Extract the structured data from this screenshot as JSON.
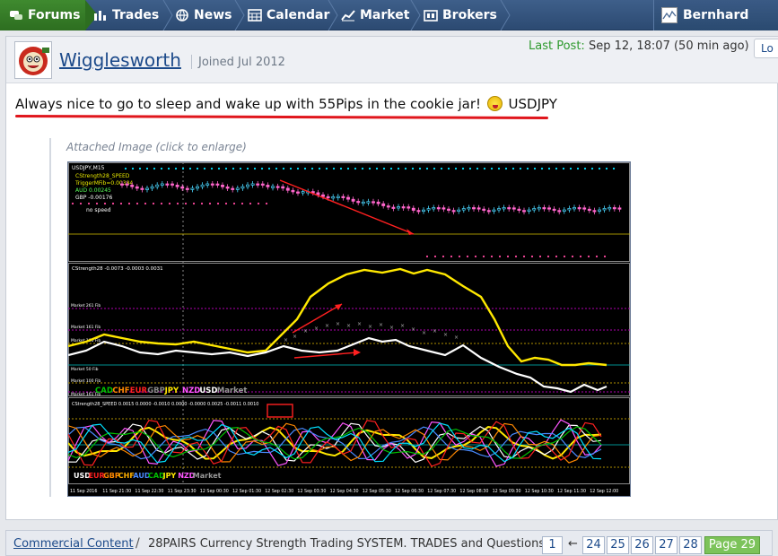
{
  "nav": {
    "items": [
      {
        "label": "Forums",
        "icon": "forums-icon"
      },
      {
        "label": "Trades",
        "icon": "bar-chart-icon"
      },
      {
        "label": "News",
        "icon": "globe-icon"
      },
      {
        "label": "Calendar",
        "icon": "calendar-icon"
      },
      {
        "label": "Market",
        "icon": "line-chart-icon"
      },
      {
        "label": "Brokers",
        "icon": "broker-icon"
      }
    ],
    "user": "Bernhard"
  },
  "post": {
    "username": "Wigglesworth",
    "joined": "Joined Jul 2012",
    "last_post_label": "Last Post:",
    "last_post_value": "Sep 12, 18:07 (50 min ago)",
    "header_button": "Lo",
    "text_before": "Always nice to go to sleep and wake up with 55Pips in the cookie jar! ",
    "text_after": " USDJPY",
    "attached_label": "Attached Image (click to enlarge)"
  },
  "chart": {
    "price_panel_title": "USDJPY,M15",
    "indicator_lines": [
      "CStrength28_SPEED",
      "TriggerMFib=0.00384",
      "AUD 0.00245",
      "GBP -0.00176",
      "no speed"
    ],
    "strength_title": "CStrength28 -0.0073 -0.0003 0.0031",
    "fib_labels": [
      "Market 261 Fib",
      "Market 161 Fib",
      "Market 100 Fib",
      "Market 50 Fib",
      "Market 100 Fib",
      "Market 161 Fib"
    ],
    "currency_legend_1": [
      "CAD",
      "CHF",
      "EUR",
      "GBP",
      "JPY",
      "NZD",
      "USD",
      "Market"
    ],
    "speed_title": "CStrength28_SPEED 0.0015 0.0000 -0.0010 0.0000 -0.0000 0.0025 -0.0011 0.0010",
    "currency_legend_2": [
      "USD",
      "EUR",
      "GBP",
      "CHF",
      "AUD",
      "CAD",
      "JPY",
      "NZD",
      "Market"
    ],
    "time_labels": [
      "11 Sep 2016",
      "11 Sep 21:30",
      "11 Sep 22:30",
      "11 Sep 23:30",
      "12 Sep 00:30",
      "12 Sep 01:30",
      "12 Sep 02:30",
      "12 Sep 03:30",
      "12 Sep 04:30",
      "12 Sep 05:30",
      "12 Sep 06:30",
      "12 Sep 07:30",
      "12 Sep 08:30",
      "12 Sep 09:30",
      "12 Sep 10:30",
      "12 Sep 11:30",
      "12 Sep 12:00"
    ]
  },
  "breadcrumb": {
    "link": "Commercial Content",
    "separator": "/",
    "title": "28PAIRS Currency Strength Trading SYSTEM. TRADES and Questions",
    "pages": [
      "1",
      "←",
      "24",
      "25",
      "26",
      "27",
      "28"
    ],
    "current_page": "Page 29"
  },
  "colors": {
    "nav_bg": "#2c4a72",
    "nav_active": "#2d6e20",
    "link": "#1c4a8a",
    "last_post_label": "#2e9a2e",
    "underline": "#e0161c",
    "pager_current": "#7cc35a"
  }
}
